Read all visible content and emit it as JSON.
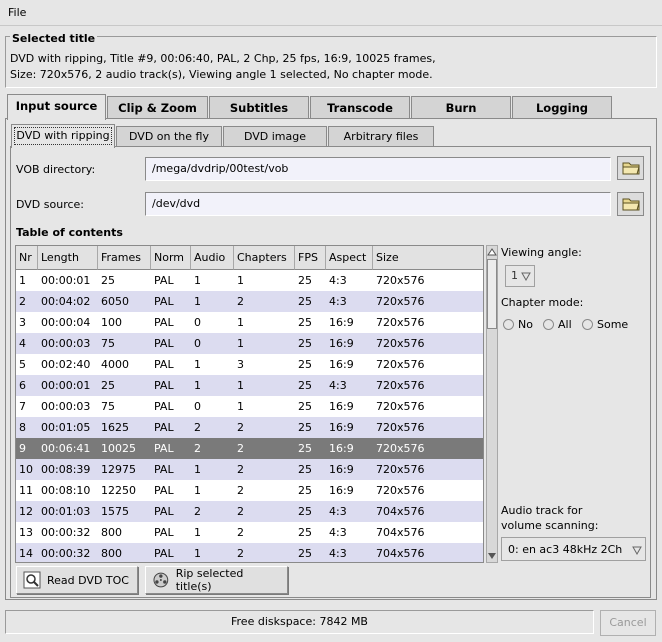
{
  "menu": {
    "file": "File"
  },
  "selected": {
    "title": "Selected title",
    "line1": "DVD with ripping, Title #9, 00:06:40, PAL, 2 Chp, 25 fps, 16:9, 10025 frames,",
    "line2": "Size: 720x576, 2 audio track(s), Viewing angle 1 selected, No chapter mode."
  },
  "tabs": [
    {
      "label": "Input source",
      "active": true
    },
    {
      "label": "Clip & Zoom"
    },
    {
      "label": "Subtitles"
    },
    {
      "label": "Transcode"
    },
    {
      "label": "Burn"
    },
    {
      "label": "Logging"
    }
  ],
  "subtabs": [
    {
      "label": "DVD with ripping",
      "active": true
    },
    {
      "label": "DVD on the fly"
    },
    {
      "label": "DVD image"
    },
    {
      "label": "Arbitrary files"
    }
  ],
  "fields": {
    "vob_label": "VOB directory:",
    "vob_value": "/mega/dvdrip/00test/vob",
    "source_label": "DVD source:",
    "source_value": "/dev/dvd"
  },
  "toc": {
    "title": "Table of contents",
    "columns": [
      "Nr",
      "Length",
      "Frames",
      "Norm",
      "Audio",
      "Chapters",
      "FPS",
      "Aspect",
      "Size"
    ],
    "rows": [
      [
        "1",
        "00:00:01",
        "25",
        "PAL",
        "1",
        "1",
        "25",
        "4:3",
        "720x576"
      ],
      [
        "2",
        "00:04:02",
        "6050",
        "PAL",
        "1",
        "2",
        "25",
        "4:3",
        "720x576"
      ],
      [
        "3",
        "00:00:04",
        "100",
        "PAL",
        "0",
        "1",
        "25",
        "16:9",
        "720x576"
      ],
      [
        "4",
        "00:00:03",
        "75",
        "PAL",
        "0",
        "1",
        "25",
        "16:9",
        "720x576"
      ],
      [
        "5",
        "00:02:40",
        "4000",
        "PAL",
        "1",
        "3",
        "25",
        "16:9",
        "720x576"
      ],
      [
        "6",
        "00:00:01",
        "25",
        "PAL",
        "1",
        "1",
        "25",
        "4:3",
        "720x576"
      ],
      [
        "7",
        "00:00:03",
        "75",
        "PAL",
        "0",
        "1",
        "25",
        "16:9",
        "720x576"
      ],
      [
        "8",
        "00:01:05",
        "1625",
        "PAL",
        "2",
        "2",
        "25",
        "16:9",
        "720x576"
      ],
      [
        "9",
        "00:06:41",
        "10025",
        "PAL",
        "2",
        "2",
        "25",
        "16:9",
        "720x576"
      ],
      [
        "10",
        "00:08:39",
        "12975",
        "PAL",
        "1",
        "2",
        "25",
        "16:9",
        "720x576"
      ],
      [
        "11",
        "00:08:10",
        "12250",
        "PAL",
        "1",
        "2",
        "25",
        "16:9",
        "720x576"
      ],
      [
        "12",
        "00:01:03",
        "1575",
        "PAL",
        "2",
        "2",
        "25",
        "4:3",
        "704x576"
      ],
      [
        "13",
        "00:00:32",
        "800",
        "PAL",
        "1",
        "2",
        "25",
        "4:3",
        "704x576"
      ],
      [
        "14",
        "00:00:32",
        "800",
        "PAL",
        "1",
        "2",
        "25",
        "4:3",
        "704x576"
      ]
    ],
    "selected_row": 9
  },
  "side": {
    "viewing_angle_label": "Viewing angle:",
    "viewing_angle_value": "1",
    "chapter_mode_label": "Chapter mode:",
    "chapter_options": [
      "No",
      "All",
      "Some"
    ],
    "audio_label_line1": "Audio track for",
    "audio_label_line2": "volume scanning:",
    "audio_value": "0: en ac3 48kHz 2Ch"
  },
  "buttons": {
    "read_toc": "Read DVD TOC",
    "rip": "Rip selected title(s)",
    "cancel": "Cancel"
  },
  "status": {
    "text": "Free diskspace: 7842 MB"
  },
  "colors": {
    "row_alt": "#dcdcf0",
    "row_selected": "#7a7a7a",
    "entry_bg": "#f2f2fa"
  }
}
